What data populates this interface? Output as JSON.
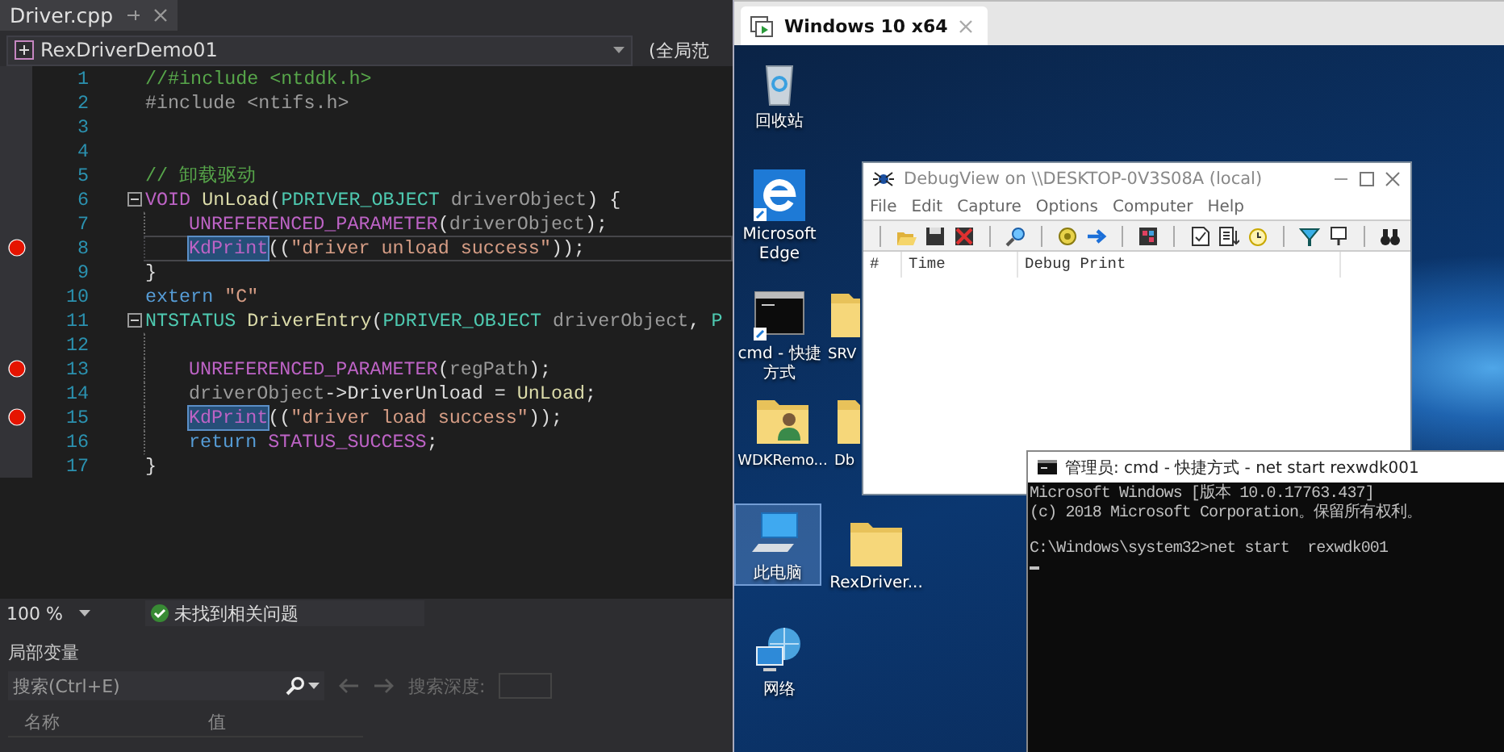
{
  "editor": {
    "tab": {
      "label": "Driver.cpp"
    },
    "nav": {
      "project": "RexDriverDemo01",
      "scope": "(全局范"
    },
    "lines": [
      {
        "number": "1",
        "breakpoint": false,
        "fold": false,
        "current": false,
        "indented": false,
        "tokens": [
          {
            "kind": "comment",
            "text": "//#include <ntddk.h>"
          }
        ]
      },
      {
        "number": "2",
        "breakpoint": false,
        "fold": false,
        "current": false,
        "indented": false,
        "tokens": [
          {
            "kind": "directive",
            "text": "#include <ntifs.h>"
          }
        ]
      },
      {
        "number": "3",
        "breakpoint": false,
        "fold": false,
        "current": false,
        "indented": false
      },
      {
        "number": "4",
        "breakpoint": false,
        "fold": false,
        "current": false,
        "indented": false
      },
      {
        "number": "5",
        "breakpoint": false,
        "fold": false,
        "current": false,
        "indented": false,
        "tokens": [
          {
            "kind": "comment",
            "text": "// 卸载驱动"
          }
        ]
      },
      {
        "number": "6",
        "breakpoint": false,
        "fold": true,
        "current": false,
        "indented": false,
        "tokens": [
          {
            "kind": "macro",
            "text": "VOID"
          },
          {
            "kind": "func",
            "text": " UnLoad"
          },
          {
            "kind": "plain",
            "text": "("
          },
          {
            "kind": "type",
            "text": "PDRIVER_OBJECT"
          },
          {
            "kind": "param",
            "text": " driverObject"
          },
          {
            "kind": "plain",
            "text": ") {"
          }
        ]
      },
      {
        "number": "7",
        "breakpoint": false,
        "fold": false,
        "current": false,
        "indented": true,
        "tokens": [
          {
            "kind": "macro",
            "text": "UNREFERENCED_PARAMETER"
          },
          {
            "kind": "plain",
            "text": "("
          },
          {
            "kind": "param",
            "text": "driverObject"
          },
          {
            "kind": "plain",
            "text": ");"
          }
        ]
      },
      {
        "number": "8",
        "breakpoint": true,
        "fold": false,
        "current": true,
        "indented": true,
        "tokens": [
          {
            "kind": "highlight",
            "text": "KdPrint"
          },
          {
            "kind": "plain",
            "text": "(("
          },
          {
            "kind": "string",
            "text": "\"driver unload success\""
          },
          {
            "kind": "plain",
            "text": "));"
          }
        ]
      },
      {
        "number": "9",
        "breakpoint": false,
        "fold": false,
        "current": false,
        "indented": false,
        "tokens": [
          {
            "kind": "plain",
            "text": "}"
          }
        ]
      },
      {
        "number": "10",
        "breakpoint": false,
        "fold": false,
        "current": false,
        "indented": false,
        "tokens": [
          {
            "kind": "keyword",
            "text": "extern"
          },
          {
            "kind": "string",
            "text": " \"C\""
          }
        ]
      },
      {
        "number": "11",
        "breakpoint": false,
        "fold": true,
        "current": false,
        "indented": false,
        "tokens": [
          {
            "kind": "type",
            "text": "NTSTATUS"
          },
          {
            "kind": "func",
            "text": " DriverEntry"
          },
          {
            "kind": "plain",
            "text": "("
          },
          {
            "kind": "type",
            "text": "PDRIVER_OBJECT"
          },
          {
            "kind": "param",
            "text": " driverObject"
          },
          {
            "kind": "plain",
            "text": ", "
          },
          {
            "kind": "type",
            "text": "P"
          }
        ]
      },
      {
        "number": "12",
        "breakpoint": false,
        "fold": false,
        "current": false,
        "indented": true
      },
      {
        "number": "13",
        "breakpoint": true,
        "fold": false,
        "current": false,
        "indented": true,
        "tokens": [
          {
            "kind": "macro",
            "text": "UNREFERENCED_PARAMETER"
          },
          {
            "kind": "plain",
            "text": "("
          },
          {
            "kind": "param",
            "text": "regPath"
          },
          {
            "kind": "plain",
            "text": ");"
          }
        ]
      },
      {
        "number": "14",
        "breakpoint": false,
        "fold": false,
        "current": false,
        "indented": true,
        "tokens": [
          {
            "kind": "param",
            "text": "driverObject"
          },
          {
            "kind": "plain",
            "text": "->DriverUnload = "
          },
          {
            "kind": "func",
            "text": "UnLoad"
          },
          {
            "kind": "plain",
            "text": ";"
          }
        ]
      },
      {
        "number": "15",
        "breakpoint": true,
        "fold": false,
        "current": false,
        "indented": true,
        "tokens": [
          {
            "kind": "highlight",
            "text": "KdPrint"
          },
          {
            "kind": "plain",
            "text": "(("
          },
          {
            "kind": "string",
            "text": "\"driver load success\""
          },
          {
            "kind": "plain",
            "text": "));"
          }
        ]
      },
      {
        "number": "16",
        "breakpoint": false,
        "fold": false,
        "current": false,
        "indented": true,
        "tokens": [
          {
            "kind": "keyword",
            "text": "return"
          },
          {
            "kind": "macro",
            "text": " STATUS_SUCCESS"
          },
          {
            "kind": "plain",
            "text": ";"
          }
        ]
      },
      {
        "number": "17",
        "breakpoint": false,
        "fold": false,
        "current": false,
        "indented": false,
        "tokens": [
          {
            "kind": "plain",
            "text": "}"
          }
        ]
      }
    ],
    "status": {
      "zoom": "100 %",
      "issues": "未找到相关问题"
    },
    "locals": {
      "title": "局部变量",
      "search": {
        "placeholder": "搜索(Ctrl+E)"
      },
      "depth_label": "搜索深度:",
      "columns": [
        "名称",
        "值"
      ]
    }
  },
  "vm": {
    "tab": {
      "label": "Windows 10 x64"
    },
    "icons": [
      {
        "kind": "recycle",
        "label": "回收站",
        "selected": false
      },
      {
        "kind": "browser",
        "label": "Microsoft Edge",
        "selected": false
      },
      {
        "kind": "terminal",
        "label": "cmd - 快捷方式",
        "selected": false
      },
      {
        "kind": "folder",
        "label": "SRV",
        "selected": false
      },
      {
        "kind": "user-folder",
        "label": "WDKRemo...",
        "selected": false
      },
      {
        "kind": "folder",
        "label": "Db",
        "selected": false
      },
      {
        "kind": "computer",
        "label": "此电脑",
        "selected": true
      },
      {
        "kind": "folder",
        "label": "RexDriver...",
        "selected": false
      },
      {
        "kind": "network",
        "label": "网络",
        "selected": false
      }
    ],
    "debugview": {
      "title": "DebugView on \\\\DESKTOP-0V3S08A (local)",
      "menu": [
        "File",
        "Edit",
        "Capture",
        "Options",
        "Computer",
        "Help"
      ],
      "columns": [
        "#",
        "Time",
        "Debug Print"
      ]
    },
    "console": {
      "title": "管理员: cmd - 快捷方式 - net  start  rexwdk001",
      "blocks": [
        [
          "Microsoft Windows [版本 10.0.17763.437]",
          "(c) 2018 Microsoft Corporation。保留所有权利。"
        ],
        [
          "C:\\Windows\\system32>net start  rexwdk001"
        ]
      ]
    }
  }
}
